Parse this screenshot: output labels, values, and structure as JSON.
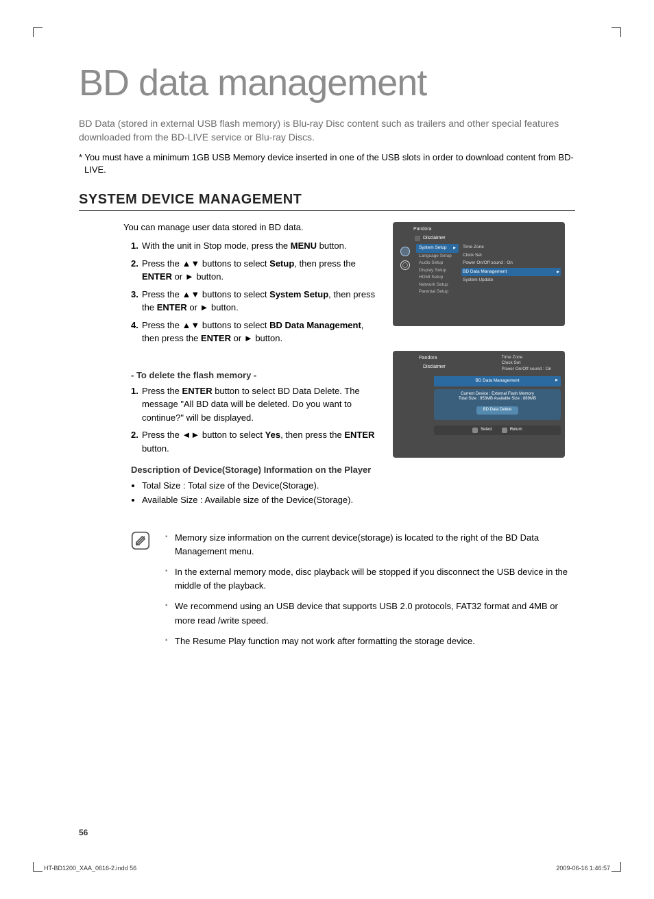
{
  "title": "BD data management",
  "intro": "BD Data (stored in external USB flash memory) is Blu-ray Disc content such as trailers and other special features downloaded from the BD-LIVE service or Blu-ray Discs.",
  "asterisk_note": "* You must have a minimum 1GB USB Memory device inserted in one of the USB slots in order to download content from BD-LIVE.",
  "section_title": "SYSTEM DEVICE MANAGEMENT",
  "lead": "You can manage user data stored in BD data.",
  "steps_a": [
    {
      "n": "1.",
      "pre": "With the unit in Stop mode, press the ",
      "bold": "MENU",
      "post": " button."
    },
    {
      "n": "2.",
      "pre": "Press the ▲▼ buttons to select ",
      "bold": "Setup",
      "post": ", then press the ",
      "bold2": "ENTER",
      "post2": " or ► button."
    },
    {
      "n": "3.",
      "pre": "Press the ▲▼ buttons to select ",
      "bold": "System Setup",
      "post": ", then press the ",
      "bold2": "ENTER",
      "post2": " or ► button."
    },
    {
      "n": "4.",
      "pre": "Press the ▲▼ buttons to select ",
      "bold": "BD Data Management",
      "post": ", then press the  ",
      "bold2": "ENTER",
      "post2": " or ► button."
    }
  ],
  "delete_head": "- To delete the flash memory -",
  "steps_b": [
    {
      "n": "1.",
      "pre": "Press the ",
      "bold": "ENTER",
      "post": " button to select BD Data Delete. The message \"All BD data will be deleted. Do you want to continue?\" will be displayed."
    },
    {
      "n": "2.",
      "pre": "Press the ◄► button to select ",
      "bold": "Yes",
      "post": ", then press the ",
      "bold2": "ENTER",
      "post2": " button."
    }
  ],
  "desc_head": "Description of Device(Storage) Information on the Player",
  "desc_items": [
    "Total Size : Total size of the Device(Storage).",
    "Available Size : Available size of the Device(Storage)."
  ],
  "tips": [
    "Memory size information on the current device(storage) is located to the right of the BD Data Management menu.",
    "In the external memory mode, disc playback will be stopped if you disconnect the USB device in the middle of the playback.",
    "We recommend using an USB device that supports USB 2.0 protocols, FAT32 format and 4MB or more read /write speed.",
    "The Resume Play function may not work after formatting the storage device."
  ],
  "page_num": "56",
  "foot_left": "HT-BD1200_XAA_0616-2.indd   56",
  "foot_right": "2009-06-16    1:46:57",
  "fig1": {
    "brand": "Pandora",
    "disclaimer": "Disclaimer",
    "mid_tab": "System Setup",
    "mid_items": [
      "Language Setup",
      "Audio Setup",
      "Display Setup",
      "HDMI Setup",
      "Network Setup",
      "Parental Setup"
    ],
    "right_items_top": [
      "Time Zone",
      "Clock Set",
      "Power On/Off sound  :  On"
    ],
    "right_sel": "BD Data Management",
    "right_after": "System Update"
  },
  "fig2": {
    "brand": "Pandora",
    "disclaimer": "Disclaimer",
    "right_items_top": [
      "Time Zone",
      "Clock Set",
      "Power On/Off sound  :  On"
    ],
    "band": "BD Data Management",
    "info_l1": "Current Device : External Flash Memory",
    "info_l2": "Total Size : 953MB     Available Size : 889MB",
    "del": "BD Data Delete",
    "ctrl_select": "Select",
    "ctrl_return": "Return"
  }
}
